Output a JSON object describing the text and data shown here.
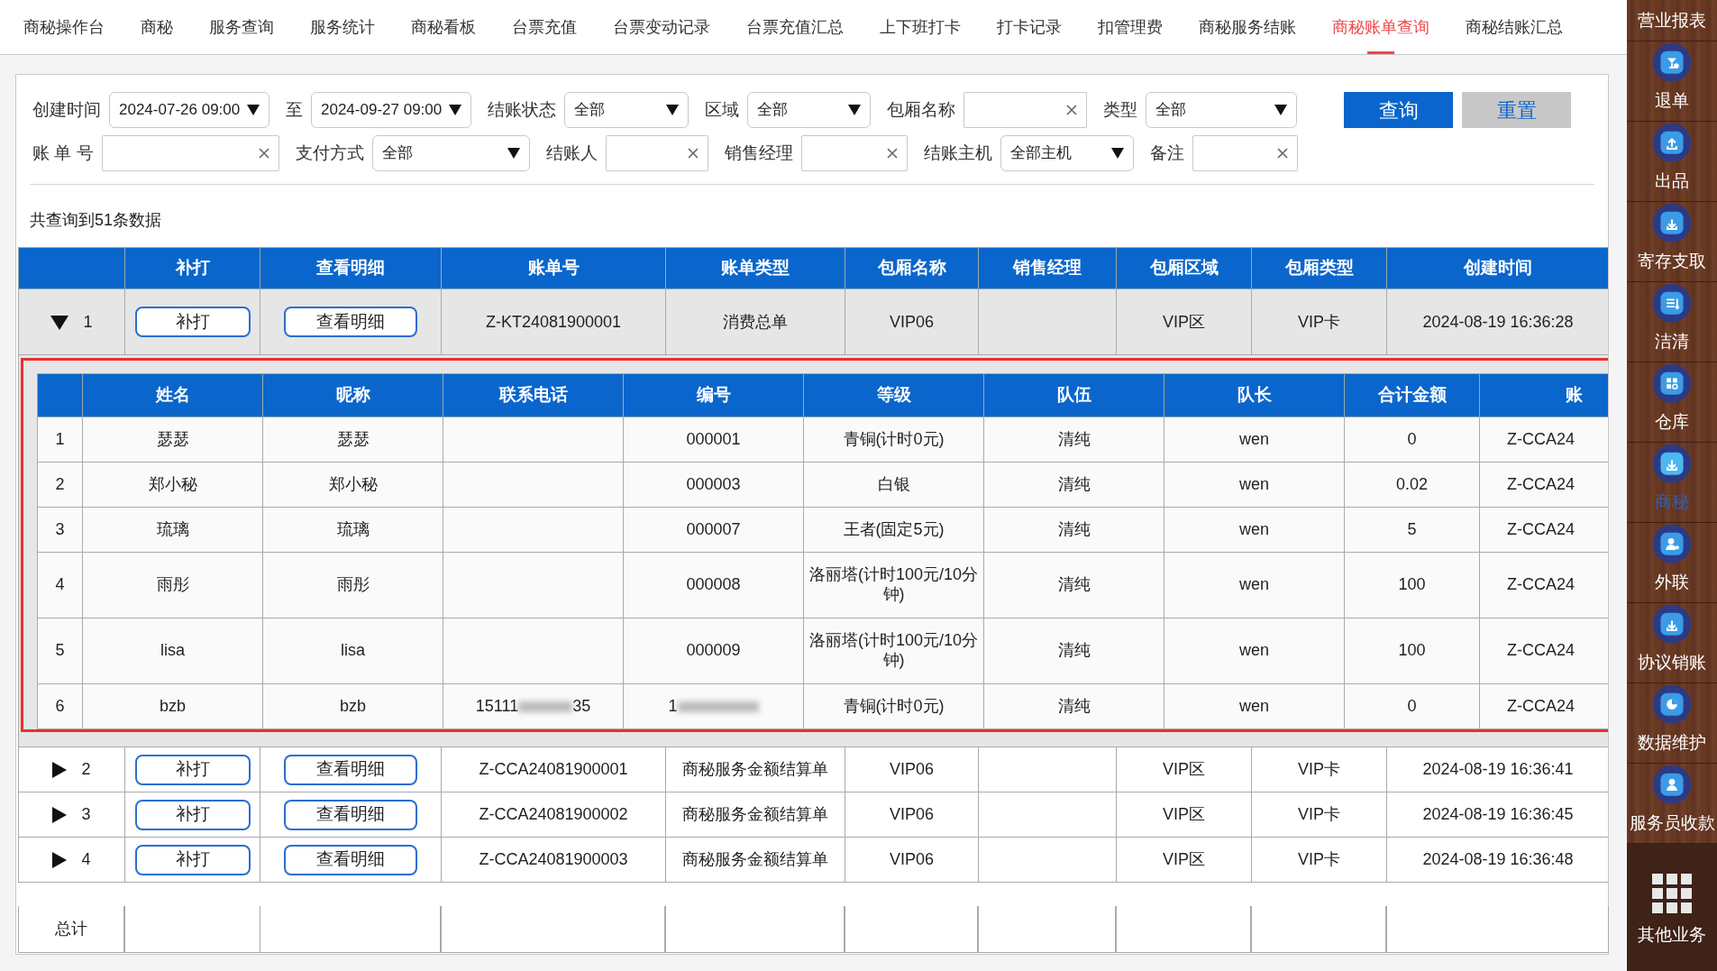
{
  "nav": {
    "items": [
      {
        "label": "商秘操作台",
        "selected": false
      },
      {
        "label": "商秘",
        "selected": false
      },
      {
        "label": "服务查询",
        "selected": false
      },
      {
        "label": "服务统计",
        "selected": false
      },
      {
        "label": "商秘看板",
        "selected": false
      },
      {
        "label": "台票充值",
        "selected": false
      },
      {
        "label": "台票变动记录",
        "selected": false
      },
      {
        "label": "台票充值汇总",
        "selected": false
      },
      {
        "label": "上下班打卡",
        "selected": false
      },
      {
        "label": "打卡记录",
        "selected": false
      },
      {
        "label": "扣管理费",
        "selected": false
      },
      {
        "label": "商秘服务结账",
        "selected": false
      },
      {
        "label": "商秘账单查询",
        "selected": true
      },
      {
        "label": "商秘结账汇总",
        "selected": false
      }
    ]
  },
  "filters": {
    "lines": [
      {
        "fields": [
          {
            "label": "创建时间",
            "kind": "select",
            "value": "2024-07-26 09:00"
          },
          {
            "label": "至",
            "kind": "select",
            "value": "2024-09-27 09:00"
          },
          {
            "label": "结账状态",
            "kind": "select",
            "value": "全部"
          },
          {
            "label": "区域",
            "kind": "select",
            "value": "全部"
          },
          {
            "label": "包厢名称",
            "kind": "input"
          },
          {
            "label": "类型",
            "kind": "select",
            "value": "全部"
          }
        ]
      },
      {
        "fields": [
          {
            "label": "账 单 号",
            "kind": "input"
          },
          {
            "label": "支付方式",
            "kind": "select",
            "value": "全部"
          },
          {
            "label": "结账人",
            "kind": "input"
          },
          {
            "label": "销售经理",
            "kind": "input"
          },
          {
            "label": "结账主机",
            "kind": "select",
            "value": "全部主机"
          },
          {
            "label": "备注",
            "kind": "input"
          }
        ]
      }
    ],
    "buttons": [
      {
        "label": "查询",
        "kind": "primary"
      },
      {
        "label": "重置",
        "kind": "secondary"
      }
    ]
  },
  "result_count": "共查询到51条数据",
  "table": {
    "columns": [
      "补打",
      "查看明细",
      "账单号",
      "账单类型",
      "包厢名称",
      "销售经理",
      "包厢区域",
      "包厢类型",
      "创建时间"
    ],
    "rows": [
      {
        "expanded": true,
        "index": "1",
        "reprint": "补打",
        "details": "查看明细",
        "bill_no": "Z-KT24081900001",
        "bill_type": "消费总单",
        "room_name": "VIP06",
        "room_area": "VIP区",
        "room_type": "VIP卡",
        "created": "2024-08-19 16:36:28"
      },
      {
        "expanded": false,
        "index": "2",
        "reprint": "补打",
        "details": "查看明细",
        "bill_no": "Z-CCA24081900001",
        "bill_type": "商秘服务金额结算单",
        "room_name": "VIP06",
        "room_area": "VIP区",
        "room_type": "VIP卡",
        "created": "2024-08-19 16:36:41"
      },
      {
        "expanded": false,
        "index": "3",
        "reprint": "补打",
        "details": "查看明细",
        "bill_no": "Z-CCA24081900002",
        "bill_type": "商秘服务金额结算单",
        "room_name": "VIP06",
        "room_area": "VIP区",
        "room_type": "VIP卡",
        "created": "2024-08-19 16:36:45"
      },
      {
        "expanded": false,
        "index": "4",
        "reprint": "补打",
        "details": "查看明细",
        "bill_no": "Z-CCA24081900003",
        "bill_type": "商秘服务金额结算单",
        "room_name": "VIP06",
        "room_area": "VIP区",
        "room_type": "VIP卡",
        "created": "2024-08-19 16:36:48"
      }
    ],
    "detail": {
      "columns": [
        "姓名",
        "昵称",
        "联系电话",
        "编号",
        "等级",
        "队伍",
        "队长",
        "合计金额",
        "账"
      ],
      "rows": [
        {
          "index": "1",
          "name": "瑟瑟",
          "nickname": "瑟瑟",
          "code": "000001",
          "level": "青铜(计时0元)",
          "team": "清纯",
          "captain": "wen",
          "total": "0",
          "bill": "Z-CCA24"
        },
        {
          "index": "2",
          "name": "郑小秘",
          "nickname": "郑小秘",
          "code": "000003",
          "level": "白银",
          "team": "清纯",
          "captain": "wen",
          "total": "0.02",
          "bill": "Z-CCA24"
        },
        {
          "index": "3",
          "name": "琉璃",
          "nickname": "琉璃",
          "code": "000007",
          "level": "王者(固定5元)",
          "team": "清纯",
          "captain": "wen",
          "total": "5",
          "bill": "Z-CCA24"
        },
        {
          "index": "4",
          "name": "雨彤",
          "nickname": "雨彤",
          "code": "000008",
          "level": "洛丽塔(计时100元/10分钟)",
          "team": "清纯",
          "captain": "wen",
          "total": "100",
          "bill": "Z-CCA24"
        },
        {
          "index": "5",
          "name": "lisa",
          "nickname": "lisa",
          "code": "000009",
          "level": "洛丽塔(计时100元/10分钟)",
          "team": "清纯",
          "captain": "wen",
          "total": "100",
          "bill": "Z-CCA24"
        },
        {
          "index": "6",
          "name": "bzb",
          "nickname": "bzb",
          "phone": {
            "prefix": "15111",
            "suffix": "35"
          },
          "code_redacted": {
            "prefix": "1"
          },
          "level": "青铜(计时0元)",
          "team": "清纯",
          "captain": "wen",
          "total": "0",
          "bill": "Z-CCA24"
        }
      ]
    },
    "footer": {
      "label": "总计"
    }
  },
  "sidebar": {
    "items": [
      {
        "label": "营业报表",
        "selected": false,
        "kind": "label"
      },
      {
        "label": "退单",
        "selected": false,
        "kind": "app"
      },
      {
        "label": "出品",
        "selected": false,
        "kind": "app"
      },
      {
        "label": "寄存支取",
        "selected": false,
        "kind": "app"
      },
      {
        "label": "洁清",
        "selected": false,
        "kind": "app"
      },
      {
        "label": "仓库",
        "selected": false,
        "kind": "app"
      },
      {
        "label": "商秘",
        "selected": true,
        "kind": "app"
      },
      {
        "label": "外联",
        "selected": false,
        "kind": "app"
      },
      {
        "label": "协议销账",
        "selected": false,
        "kind": "app"
      },
      {
        "label": "数据维护",
        "selected": false,
        "kind": "app"
      },
      {
        "label": "服务员收款",
        "selected": false,
        "kind": "app"
      },
      {
        "label": "其他业务",
        "selected": false,
        "kind": "more"
      }
    ]
  }
}
